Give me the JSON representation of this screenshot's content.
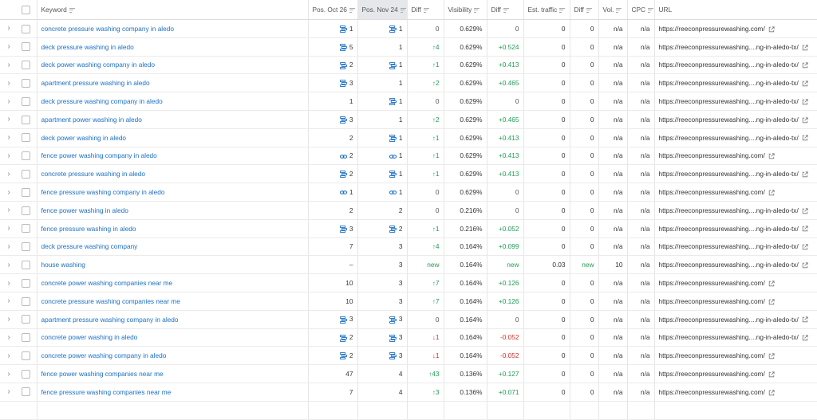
{
  "columns": {
    "keyword": "Keyword",
    "pos1": "Pos. Oct 26",
    "pos2": "Pos. Nov 24",
    "diff1": "Diff",
    "visibility": "Visibility",
    "diff2": "Diff",
    "traffic": "Est. traffic",
    "diff3": "Diff",
    "vol": "Vol.",
    "cpc": "CPC",
    "url": "URL"
  },
  "rows": [
    {
      "keyword": "concrete pressure washing company in aledo",
      "p1_icon": "serp",
      "p1": "1",
      "p2_icon": "serp",
      "p2": "1",
      "diff": "0",
      "dir": "none",
      "vis": "0.629%",
      "vd": "0",
      "vdc": "none",
      "traffic": "0",
      "td": "0",
      "vol": "n/a",
      "cpc": "n/a",
      "url": "https://reeconpressurewashing.com/",
      "ext": true
    },
    {
      "keyword": "deck pressure washing in aledo",
      "p1_icon": "serp",
      "p1": "5",
      "p2_icon": "",
      "p2": "1",
      "diff": "4",
      "dir": "up",
      "vis": "0.629%",
      "vd": "+0.524",
      "vdc": "pos",
      "traffic": "0",
      "td": "0",
      "vol": "n/a",
      "cpc": "n/a",
      "url": "https://reeconpressurewashing....ng-in-aledo-tx/",
      "ext": true
    },
    {
      "keyword": "deck power washing company in aledo",
      "p1_icon": "serp",
      "p1": "2",
      "p2_icon": "serp",
      "p2": "1",
      "diff": "1",
      "dir": "up",
      "vis": "0.629%",
      "vd": "+0.413",
      "vdc": "pos",
      "traffic": "0",
      "td": "0",
      "vol": "n/a",
      "cpc": "n/a",
      "url": "https://reeconpressurewashing....ng-in-aledo-tx/",
      "ext": true
    },
    {
      "keyword": "apartment pressure washing in aledo",
      "p1_icon": "serp",
      "p1": "3",
      "p2_icon": "",
      "p2": "1",
      "diff": "2",
      "dir": "up",
      "vis": "0.629%",
      "vd": "+0.465",
      "vdc": "pos",
      "traffic": "0",
      "td": "0",
      "vol": "n/a",
      "cpc": "n/a",
      "url": "https://reeconpressurewashing....ng-in-aledo-tx/",
      "ext": true
    },
    {
      "keyword": "deck pressure washing company in aledo",
      "p1_icon": "",
      "p1": "1",
      "p2_icon": "serp",
      "p2": "1",
      "diff": "0",
      "dir": "none",
      "vis": "0.629%",
      "vd": "0",
      "vdc": "none",
      "traffic": "0",
      "td": "0",
      "vol": "n/a",
      "cpc": "n/a",
      "url": "https://reeconpressurewashing....ng-in-aledo-tx/",
      "ext": true
    },
    {
      "keyword": "apartment power washing in aledo",
      "p1_icon": "serp",
      "p1": "3",
      "p2_icon": "",
      "p2": "1",
      "diff": "2",
      "dir": "up",
      "vis": "0.629%",
      "vd": "+0.465",
      "vdc": "pos",
      "traffic": "0",
      "td": "0",
      "vol": "n/a",
      "cpc": "n/a",
      "url": "https://reeconpressurewashing....ng-in-aledo-tx/",
      "ext": true
    },
    {
      "keyword": "deck power washing in aledo",
      "p1_icon": "",
      "p1": "2",
      "p2_icon": "serp",
      "p2": "1",
      "diff": "1",
      "dir": "up",
      "vis": "0.629%",
      "vd": "+0.413",
      "vdc": "pos",
      "traffic": "0",
      "td": "0",
      "vol": "n/a",
      "cpc": "n/a",
      "url": "https://reeconpressurewashing....ng-in-aledo-tx/",
      "ext": true
    },
    {
      "keyword": "fence power washing company in aledo",
      "p1_icon": "link",
      "p1": "2",
      "p2_icon": "link",
      "p2": "1",
      "diff": "1",
      "dir": "up",
      "vis": "0.629%",
      "vd": "+0.413",
      "vdc": "pos",
      "traffic": "0",
      "td": "0",
      "vol": "n/a",
      "cpc": "n/a",
      "url": "https://reeconpressurewashing.com/",
      "ext": true
    },
    {
      "keyword": "concrete pressure washing in aledo",
      "p1_icon": "serp",
      "p1": "2",
      "p2_icon": "serp",
      "p2": "1",
      "diff": "1",
      "dir": "up",
      "vis": "0.629%",
      "vd": "+0.413",
      "vdc": "pos",
      "traffic": "0",
      "td": "0",
      "vol": "n/a",
      "cpc": "n/a",
      "url": "https://reeconpressurewashing....ng-in-aledo-tx/",
      "ext": true
    },
    {
      "keyword": "fence pressure washing company in aledo",
      "p1_icon": "link",
      "p1": "1",
      "p2_icon": "link",
      "p2": "1",
      "diff": "0",
      "dir": "none",
      "vis": "0.629%",
      "vd": "0",
      "vdc": "none",
      "traffic": "0",
      "td": "0",
      "vol": "n/a",
      "cpc": "n/a",
      "url": "https://reeconpressurewashing.com/",
      "ext": true
    },
    {
      "keyword": "fence power washing in aledo",
      "p1_icon": "",
      "p1": "2",
      "p2_icon": "",
      "p2": "2",
      "diff": "0",
      "dir": "none",
      "vis": "0.216%",
      "vd": "0",
      "vdc": "none",
      "traffic": "0",
      "td": "0",
      "vol": "n/a",
      "cpc": "n/a",
      "url": "https://reeconpressurewashing....ng-in-aledo-tx/",
      "ext": true
    },
    {
      "keyword": "fence pressure washing in aledo",
      "p1_icon": "serp",
      "p1": "3",
      "p2_icon": "serp",
      "p2": "2",
      "diff": "1",
      "dir": "up",
      "vis": "0.216%",
      "vd": "+0.052",
      "vdc": "pos",
      "traffic": "0",
      "td": "0",
      "vol": "n/a",
      "cpc": "n/a",
      "url": "https://reeconpressurewashing....ng-in-aledo-tx/",
      "ext": true
    },
    {
      "keyword": "deck pressure washing company",
      "p1_icon": "",
      "p1": "7",
      "p2_icon": "",
      "p2": "3",
      "diff": "4",
      "dir": "up",
      "vis": "0.164%",
      "vd": "+0.099",
      "vdc": "pos",
      "traffic": "0",
      "td": "0",
      "vol": "n/a",
      "cpc": "n/a",
      "url": "https://reeconpressurewashing....ng-in-aledo-tx/",
      "ext": true
    },
    {
      "keyword": "house washing",
      "p1_icon": "",
      "p1": "–",
      "p2_icon": "",
      "p2": "3",
      "diff": "new",
      "dir": "new",
      "vis": "0.164%",
      "vd": "new",
      "vdc": "pos",
      "traffic": "0.03",
      "td": "new",
      "vol": "10",
      "cpc": "n/a",
      "url": "https://reeconpressurewashing....ng-in-aledo-tx/",
      "ext": true
    },
    {
      "keyword": "concrete power washing companies near me",
      "p1_icon": "",
      "p1": "10",
      "p2_icon": "",
      "p2": "3",
      "diff": "7",
      "dir": "up",
      "vis": "0.164%",
      "vd": "+0.126",
      "vdc": "pos",
      "traffic": "0",
      "td": "0",
      "vol": "n/a",
      "cpc": "n/a",
      "url": "https://reeconpressurewashing.com/",
      "ext": true
    },
    {
      "keyword": "concrete pressure washing companies near me",
      "p1_icon": "",
      "p1": "10",
      "p2_icon": "",
      "p2": "3",
      "diff": "7",
      "dir": "up",
      "vis": "0.164%",
      "vd": "+0.126",
      "vdc": "pos",
      "traffic": "0",
      "td": "0",
      "vol": "n/a",
      "cpc": "n/a",
      "url": "https://reeconpressurewashing.com/",
      "ext": true
    },
    {
      "keyword": "apartment pressure washing company in aledo",
      "p1_icon": "serp",
      "p1": "3",
      "p2_icon": "serp",
      "p2": "3",
      "diff": "0",
      "dir": "none",
      "vis": "0.164%",
      "vd": "0",
      "vdc": "none",
      "traffic": "0",
      "td": "0",
      "vol": "n/a",
      "cpc": "n/a",
      "url": "https://reeconpressurewashing....ng-in-aledo-tx/",
      "ext": true
    },
    {
      "keyword": "concrete power washing in aledo",
      "p1_icon": "serp",
      "p1": "2",
      "p2_icon": "serp",
      "p2": "3",
      "diff": "1",
      "dir": "down",
      "vis": "0.164%",
      "vd": "-0.052",
      "vdc": "neg",
      "traffic": "0",
      "td": "0",
      "vol": "n/a",
      "cpc": "n/a",
      "url": "https://reeconpressurewashing....ng-in-aledo-tx/",
      "ext": true
    },
    {
      "keyword": "concrete power washing company in aledo",
      "p1_icon": "serp",
      "p1": "2",
      "p2_icon": "serp",
      "p2": "3",
      "diff": "1",
      "dir": "down",
      "vis": "0.164%",
      "vd": "-0.052",
      "vdc": "neg",
      "traffic": "0",
      "td": "0",
      "vol": "n/a",
      "cpc": "n/a",
      "url": "https://reeconpressurewashing.com/",
      "ext": true
    },
    {
      "keyword": "fence power washing companies near me",
      "p1_icon": "",
      "p1": "47",
      "p2_icon": "",
      "p2": "4",
      "diff": "43",
      "dir": "up",
      "vis": "0.136%",
      "vd": "+0.127",
      "vdc": "pos",
      "traffic": "0",
      "td": "0",
      "vol": "n/a",
      "cpc": "n/a",
      "url": "https://reeconpressurewashing.com/",
      "ext": true
    },
    {
      "keyword": "fence pressure washing companies near me",
      "p1_icon": "",
      "p1": "7",
      "p2_icon": "",
      "p2": "4",
      "diff": "3",
      "dir": "up",
      "vis": "0.136%",
      "vd": "+0.071",
      "vdc": "pos",
      "traffic": "0",
      "td": "0",
      "vol": "n/a",
      "cpc": "n/a",
      "url": "https://reeconpressurewashing.com/",
      "ext": true
    },
    {
      "keyword": "",
      "p1_icon": "",
      "p1": "",
      "p2_icon": "",
      "p2": "",
      "diff": "",
      "dir": "none",
      "vis": "",
      "vd": "",
      "vdc": "none",
      "traffic": "",
      "td": "",
      "vol": "",
      "cpc": "",
      "url": "",
      "ext": false
    }
  ]
}
